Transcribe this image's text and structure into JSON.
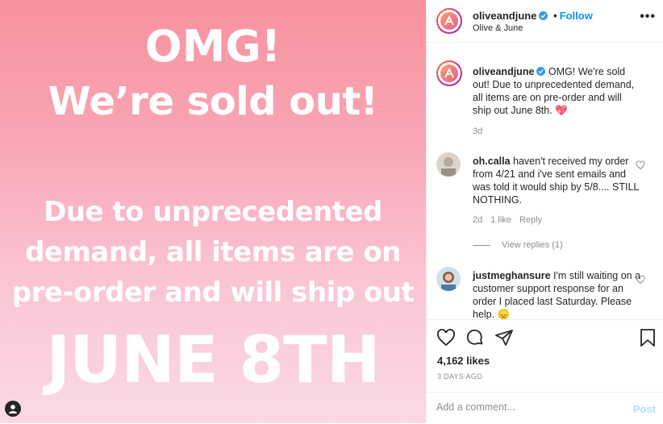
{
  "post_image": {
    "line1": "OMG!",
    "line2": "We’re sold out!",
    "line3a": "Due to unprecedented",
    "line3b": "demand, all items are on",
    "line3c": "pre-order and will ship out",
    "line4": "JUNE 8TH"
  },
  "header": {
    "username": "oliveandjune",
    "dot": "•",
    "follow_label": "Follow",
    "subtitle": "Olive & June",
    "more_label": "•••"
  },
  "caption": {
    "username": "oliveandjune",
    "text": "OMG! We're sold out! Due to unprecedented demand, all items are on pre-order and will ship out June 8th. 💖",
    "time": "3d"
  },
  "comments": [
    {
      "username": "oh.calla",
      "text": "haven't received my order from 4/21 and i've sent emails and was told it would ship by 5/8.... STILL NOTHING.",
      "time": "2d",
      "likes": "1 like",
      "reply": "Reply"
    },
    {
      "username": "justmeghansure",
      "text": "I'm still waiting on a customer support response for an order I placed last Saturday. Please help. 😞"
    }
  ],
  "view_replies": "View replies (1)",
  "likes_count": "4,162 likes",
  "posted_ago": "3 DAYS AGO",
  "add_comment": {
    "placeholder": "Add a comment...",
    "post_label": "Post"
  },
  "colors": {
    "accent": "#0095f6",
    "post_disabled": "#b2dffc",
    "image_gradient_top": "#f7929f",
    "image_gradient_bottom": "#fbd9e6"
  },
  "icons": [
    "user-tag-icon",
    "verified-icon",
    "more-options-icon",
    "heart-icon",
    "comment-icon",
    "share-icon",
    "bookmark-icon"
  ]
}
